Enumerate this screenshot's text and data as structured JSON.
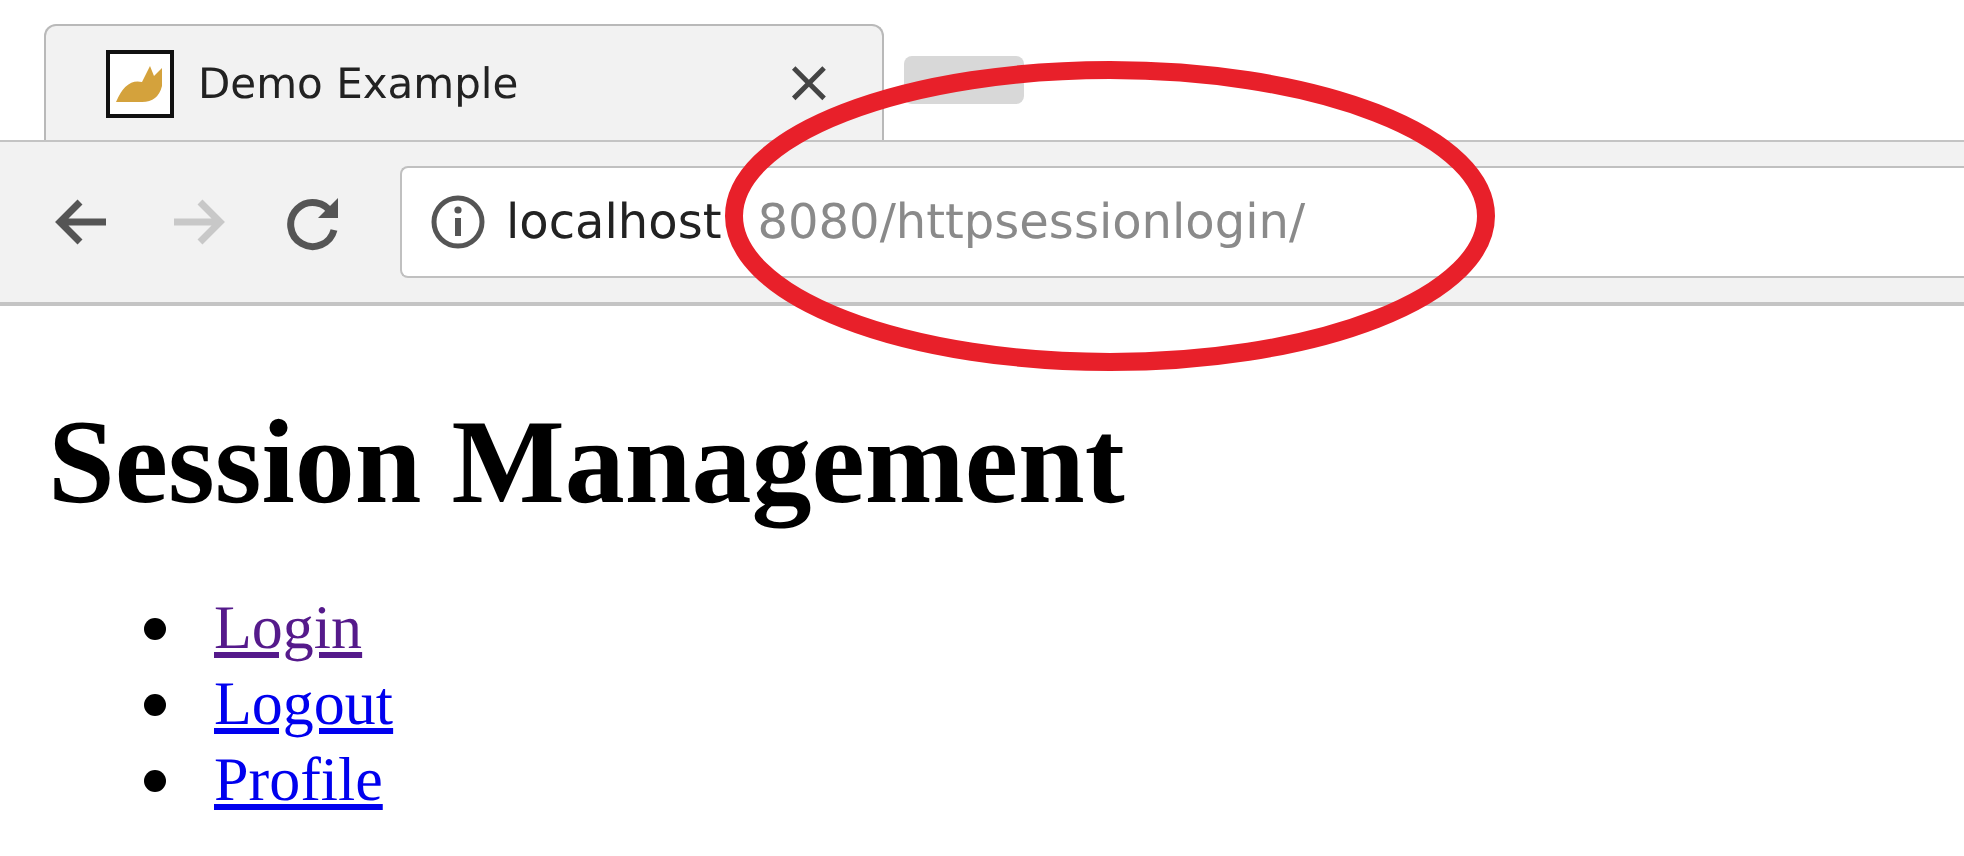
{
  "tab": {
    "title": "Demo Example",
    "close": "×"
  },
  "address": {
    "host": "localhost",
    "rest": "8080/httpsessionlogin/"
  },
  "annotation": {
    "kind": "ellipse",
    "color": "#e8202a"
  },
  "heading": "Session Management",
  "links": [
    {
      "label": "Login",
      "visited": true
    },
    {
      "label": "Logout",
      "visited": false
    },
    {
      "label": "Profile",
      "visited": false
    }
  ]
}
